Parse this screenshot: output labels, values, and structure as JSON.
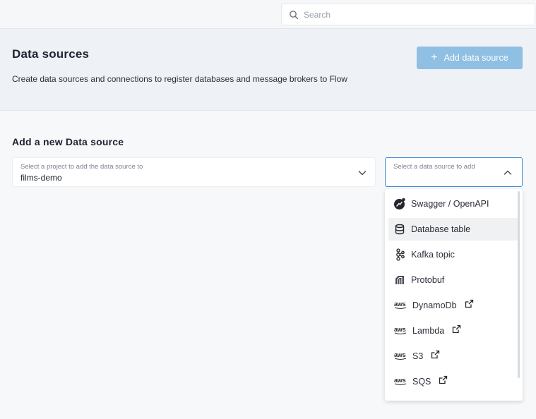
{
  "topbar": {
    "search_placeholder": "Search"
  },
  "header": {
    "title": "Data sources",
    "description": "Create data sources and connections to register databases and message brokers to Flow",
    "add_button_label": "Add data source",
    "add_button_color": "#8fbfe2"
  },
  "form": {
    "section_title": "Add a new Data source",
    "project_select": {
      "label": "Select a project to add the data source to",
      "value": "films-demo"
    },
    "source_select": {
      "label": "Select a data source to add",
      "focus_color": "#3d8bd4"
    }
  },
  "dropdown": {
    "options": [
      {
        "label": "Swagger / OpenAPI",
        "icon": "swagger-icon",
        "external": false
      },
      {
        "label": "Database table",
        "icon": "database-icon",
        "external": false
      },
      {
        "label": "Kafka topic",
        "icon": "kafka-icon",
        "external": false
      },
      {
        "label": "Protobuf",
        "icon": "protobuf-icon",
        "external": false
      },
      {
        "label": "DynamoDb",
        "icon": "aws-icon",
        "external": true
      },
      {
        "label": "Lambda",
        "icon": "aws-icon",
        "external": true
      },
      {
        "label": "S3",
        "icon": "aws-icon",
        "external": true
      },
      {
        "label": "SQS",
        "icon": "aws-icon",
        "external": true
      }
    ]
  }
}
